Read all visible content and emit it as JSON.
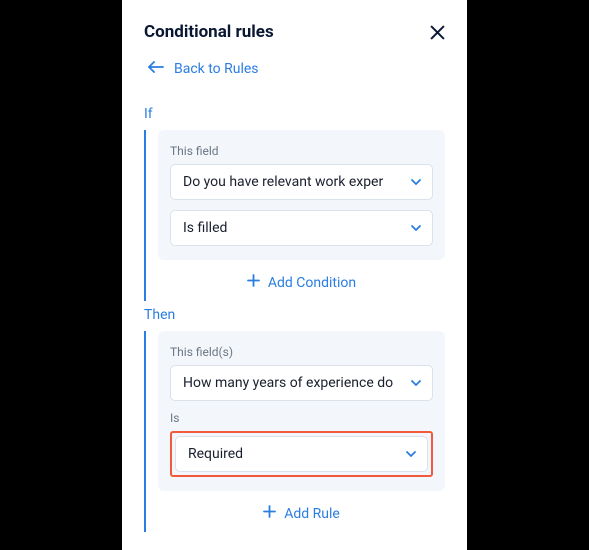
{
  "header": {
    "title": "Conditional rules",
    "back_label": "Back to Rules"
  },
  "if_block": {
    "section_label": "If",
    "field_label": "This field",
    "field_value": "Do you have relevant work exper",
    "condition_value": "Is filled",
    "add_label": "Add Condition"
  },
  "then_block": {
    "section_label": "Then",
    "fields_label": "This field(s)",
    "fields_value": "How many years of experience do",
    "is_label": "Is",
    "is_value": "Required",
    "add_label": "Add Rule"
  }
}
